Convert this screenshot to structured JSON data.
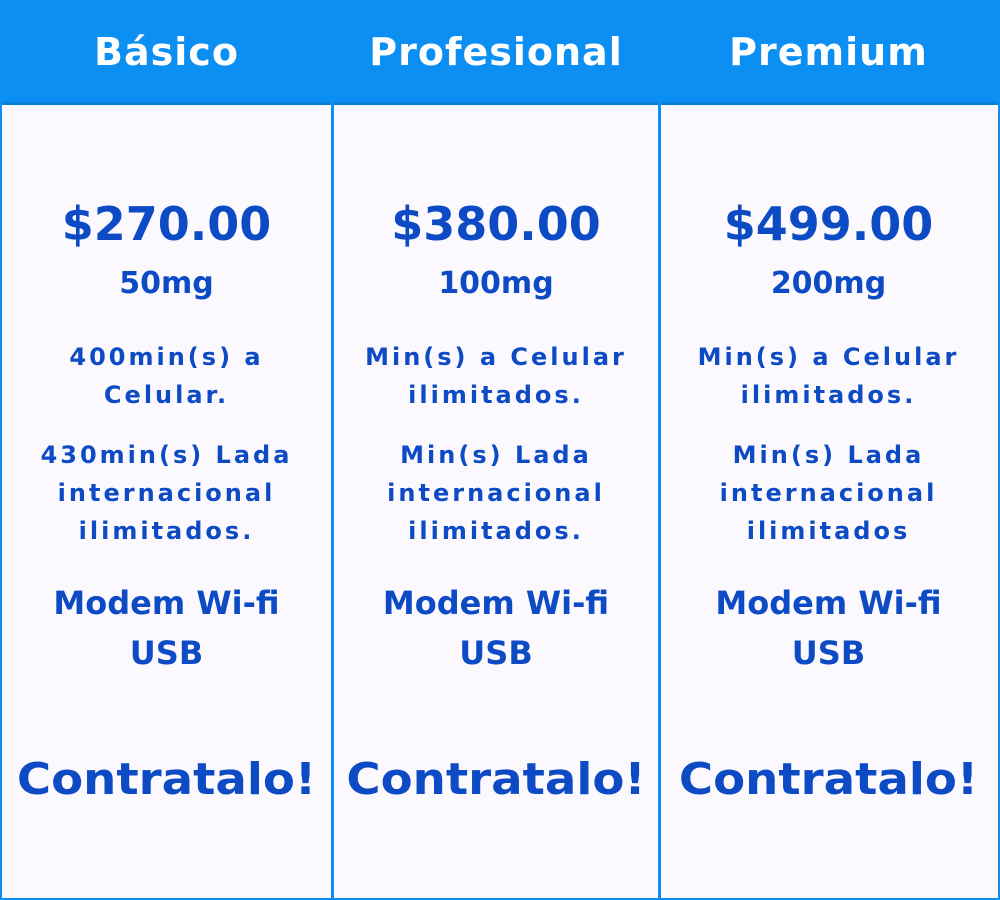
{
  "plans": [
    {
      "name": "Básico",
      "price": "$270.00",
      "data": "50mg",
      "feature_1": "400min(s) a Celular.",
      "feature_2": "430min(s) Lada internacional ilimitados.",
      "modem": "Modem Wi-fi USB",
      "cta": "Contratalo!"
    },
    {
      "name": "Profesional",
      "price": "$380.00",
      "data": "100mg",
      "feature_1": "Min(s) a Celular ilimitados.",
      "feature_2": "Min(s) Lada internacional ilimitados.",
      "modem": "Modem Wi-fi USB",
      "cta": "Contratalo!"
    },
    {
      "name": "Premium",
      "price": "$499.00",
      "data": "200mg",
      "feature_1": "Min(s) a Celular ilimitados.",
      "feature_2": "Min(s) Lada internacional ilimitados",
      "modem": "Modem Wi-fi USB",
      "cta": "Contratalo!"
    }
  ],
  "colors": {
    "header": "#0b8ff3",
    "text": "#0d4bc5",
    "background": "#fcf9fe"
  }
}
